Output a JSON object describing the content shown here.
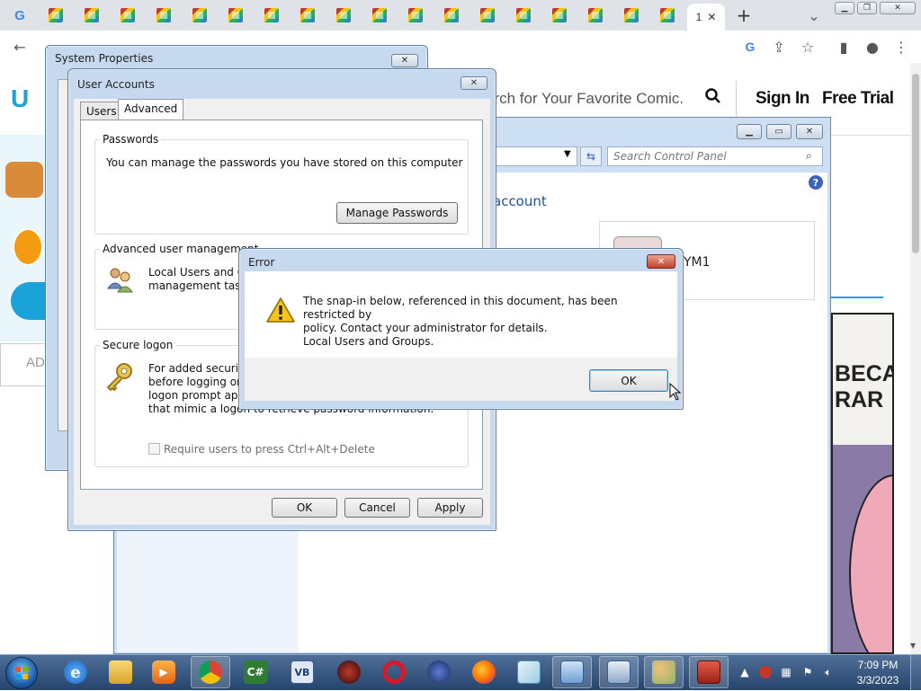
{
  "browser": {
    "active_tab_label": "1",
    "omnibox_text": "",
    "tab_icons": [
      "google-g-icon",
      "comic-favicon",
      "comic-favicon",
      "comic-favicon",
      "comic-favicon",
      "comic-favicon",
      "comic-favicon",
      "comic-favicon",
      "comic-favicon",
      "comic-favicon",
      "comic-favicon",
      "comic-favicon",
      "comic-favicon",
      "comic-favicon",
      "comic-favicon",
      "comic-favicon",
      "comic-favicon",
      "comic-favicon",
      "comic-favicon"
    ]
  },
  "webpage": {
    "search_placeholder": "arch for Your Favorite Comic.",
    "signin_label": "Sign In",
    "freetrial_label": "Free Trial",
    "ad_label": "AD",
    "comic_text": "BECA\nRAR"
  },
  "control_panel": {
    "search_placeholder": "Search Control Panel",
    "account_link": "account",
    "username_fragment": "YM1"
  },
  "system_properties": {
    "title": "System Properties"
  },
  "user_accounts": {
    "title": "User Accounts",
    "tabs": [
      "Users",
      "Advanced"
    ],
    "passwords": {
      "label": "Passwords",
      "text": "You can manage the passwords you have stored on this computer",
      "button": "Manage Passwords"
    },
    "advanced_mgmt": {
      "label": "Advanced user management",
      "line1": "Local Users and Gr",
      "line2": "management tasks"
    },
    "secure_logon": {
      "label": "Secure logon",
      "line1": "For added security,",
      "line2": "before logging on.",
      "line3": "logon prompt appe",
      "line4": "that mimic a logon to retrieve password information.",
      "checkbox_label": "Require users to press Ctrl+Alt+Delete",
      "checkbox_checked": false
    },
    "buttons": {
      "ok": "OK",
      "cancel": "Cancel",
      "apply": "Apply"
    }
  },
  "error_dialog": {
    "title": "Error",
    "message_line1": "The snap-in below, referenced in this document, has been restricted by",
    "message_line2": "policy. Contact your administrator for details.",
    "message_line3": "Local Users and Groups.",
    "ok_label": "OK"
  },
  "taskbar": {
    "time": "7:09 PM",
    "date": "3/3/2023",
    "apps": [
      "internet-explorer",
      "file-explorer",
      "media-player",
      "chrome",
      "csharp-app",
      "vb-app",
      "tool-app",
      "opera",
      "vpn-app",
      "firefox",
      "notepad-app",
      "control-panel",
      "system-app",
      "users-app",
      "toolbox-app"
    ]
  },
  "colors": {
    "accent": "#1aa3d9",
    "error_close": "#c2412a",
    "taskbar": "#26456d"
  }
}
